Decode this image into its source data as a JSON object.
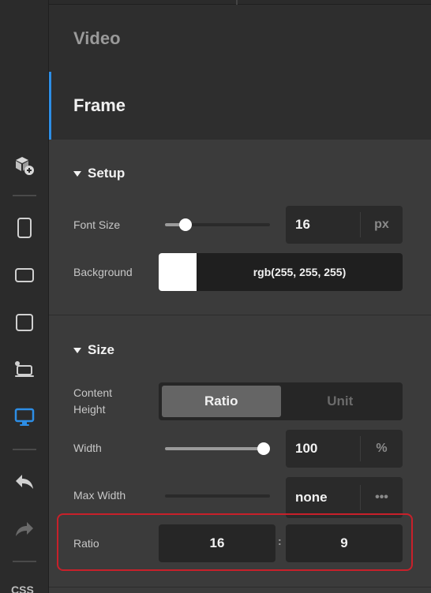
{
  "sections": {
    "video_label": "Video",
    "frame_label": "Frame"
  },
  "setup": {
    "title": "Setup",
    "font_size": {
      "label": "Font Size",
      "value": "16",
      "unit": "px",
      "slider_level_pct": 15
    },
    "background": {
      "label": "Background",
      "value": "rgb(255, 255, 255)",
      "swatch_color": "#ffffff"
    }
  },
  "size": {
    "title": "Size",
    "content_height": {
      "label_line1": "Content",
      "label_line2": "Height",
      "options": [
        "Ratio",
        "Unit"
      ],
      "selected": "Ratio"
    },
    "width": {
      "label": "Width",
      "value": "100",
      "unit": "%",
      "slider_level_pct": 100
    },
    "max_width": {
      "label": "Max Width",
      "value": "none",
      "unit": "•••"
    },
    "ratio": {
      "label": "Ratio",
      "left": "16",
      "separator": ":",
      "right": "9"
    }
  },
  "rail": {
    "icons": [
      "add-block-icon",
      "mobile-device-icon",
      "tablet-landscape-icon",
      "tablet-square-icon",
      "laptop-icon",
      "desktop-icon",
      "undo-icon",
      "redo-icon"
    ],
    "active_icon": "desktop-icon",
    "bottom_text": "CSS"
  },
  "colors": {
    "accent": "#2d8ee6",
    "highlight": "#c8202a"
  }
}
